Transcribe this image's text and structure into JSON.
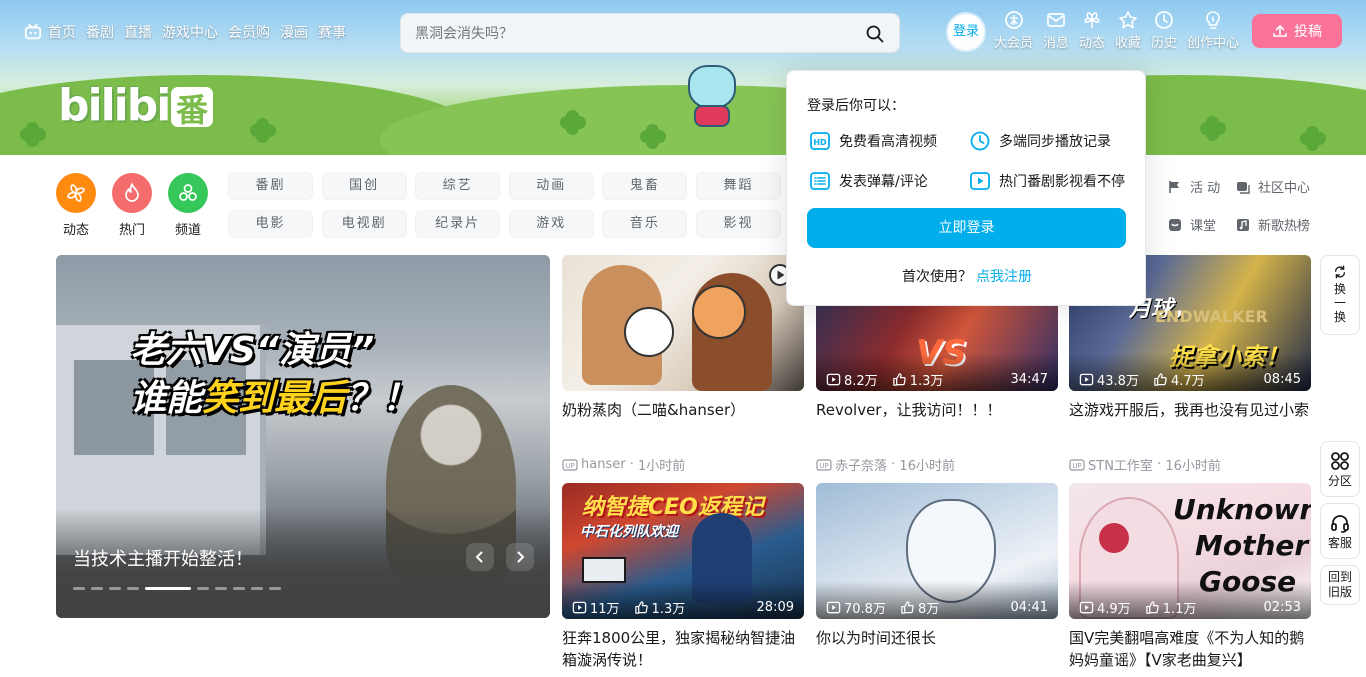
{
  "nav": {
    "items": [
      "首页",
      "番剧",
      "直播",
      "游戏中心",
      "会员购",
      "漫画",
      "赛事"
    ],
    "search_placeholder": "黑洞会消失吗？",
    "login_label": "登录",
    "right_entries": [
      "大会员",
      "消息",
      "动态",
      "收藏",
      "历史",
      "创作中心"
    ],
    "upload_label": "投稿"
  },
  "banner": {
    "logo": "bilibili",
    "badge": "番"
  },
  "channels": {
    "main": [
      {
        "label": "动态",
        "color": "#ff8a10"
      },
      {
        "label": "热门",
        "color": "#f56c6c"
      },
      {
        "label": "频道",
        "color": "#35c759"
      }
    ],
    "chips": [
      "番剧",
      "国创",
      "综艺",
      "动画",
      "鬼畜",
      "舞蹈",
      "电影",
      "电视剧",
      "纪录片",
      "游戏",
      "音乐",
      "影视"
    ],
    "side": [
      "活 动",
      "社区中心",
      "课堂",
      "新歌热榜"
    ]
  },
  "carousel": {
    "headline_a": "老六VS“演员”",
    "headline_b_pre": "谁能",
    "headline_b_hl": "笑到最后",
    "headline_b_post": "？！",
    "caption": "当技术主播开始整活！",
    "slide_count": 10,
    "active_index": 4
  },
  "videos": [
    {
      "title": "奶粉蒸肉（二喵&hanser）",
      "owner": "hanser",
      "time": "1小时前",
      "views": "",
      "likes": "",
      "duration": ""
    },
    {
      "title": "Revolver，让我访问！！！",
      "owner": "赤子奈落",
      "time": "16小时前",
      "views": "8.2万",
      "likes": "1.3万",
      "duration": "34:47"
    },
    {
      "title": "这游戏开服后，我再也没有见过小索",
      "owner": "STN工作室",
      "time": "16小时前",
      "views": "43.8万",
      "likes": "4.7万",
      "duration": "08:45"
    },
    {
      "title": "狂奔1800公里，独家揭秘纳智捷油箱漩涡传说！",
      "owner": "",
      "time": "",
      "views": "11万",
      "likes": "1.3万",
      "duration": "28:09"
    },
    {
      "title": "你以为时间还很长",
      "owner": "",
      "time": "",
      "views": "70.8万",
      "likes": "8万",
      "duration": "04:41"
    },
    {
      "title": "国V完美翻唱高难度《不为人知的鹅妈妈童谣》【V家老曲复兴】",
      "owner": "",
      "time": "",
      "views": "4.9万",
      "likes": "1.1万",
      "duration": "02:53"
    }
  ],
  "thumb_text": {
    "v2": "VS",
    "v3a": "月球，",
    "v3b": "ENDWALKER",
    "v3c": "捉拿小索！",
    "v4a": "纳智捷CEO返程记",
    "v4b": "中石化列队欢迎",
    "v6a": "Unknown",
    "v6b": "Mother",
    "v6c": "Goose"
  },
  "popover": {
    "title": "登录后你可以：",
    "features": [
      "免费看高清视频",
      "多端同步播放记录",
      "发表弹幕/评论",
      "热门番剧影视看不停"
    ],
    "button": "立即登录",
    "register_prompt": "首次使用？",
    "register_link": "点我注册"
  },
  "floating": {
    "refresh": [
      "换",
      "一",
      "换"
    ],
    "zone": "分区",
    "service": "客服",
    "old_a": "回到",
    "old_b": "旧版"
  }
}
